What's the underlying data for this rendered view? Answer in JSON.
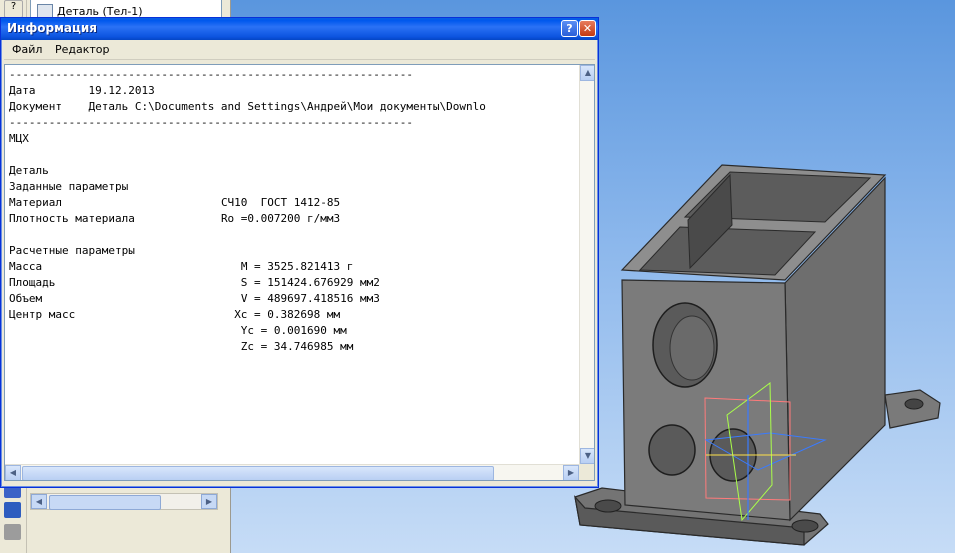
{
  "tree": {
    "item_label": "Деталь (Тел-1)"
  },
  "window": {
    "title": "Информация",
    "help_glyph": "?",
    "close_glyph": "✕",
    "menu": [
      "Файл",
      "Редактор"
    ]
  },
  "report": {
    "separator": "-------------------------------------------------------------",
    "date_label": "Дата",
    "date_value": "19.12.2013",
    "document_label": "Документ",
    "document_value": "Деталь C:\\Documents and Settings\\Андрей\\Мои документы\\Downlo",
    "section": "МЦХ",
    "object": "Деталь",
    "given_title": "Заданные параметры",
    "material_label": "Материал",
    "material_value": "СЧ10  ГОСТ 1412-85",
    "density_label": "Плотность материала",
    "density_value": "Ro =0.007200 г/мм3",
    "calc_title": "Расчетные параметры",
    "mass_label": "Масса",
    "mass_value": "M = 3525.821413 г",
    "area_label": "Площадь",
    "area_value": "S = 151424.676929 мм2",
    "volume_label": "Объем",
    "volume_value": "V = 489697.418516 мм3",
    "center_label": "Центр масс",
    "xc_value": "Xc = 0.382698 мм",
    "yc_value": "Yc = 0.001690 мм",
    "zc_value": "Zc = 34.746985 мм"
  }
}
